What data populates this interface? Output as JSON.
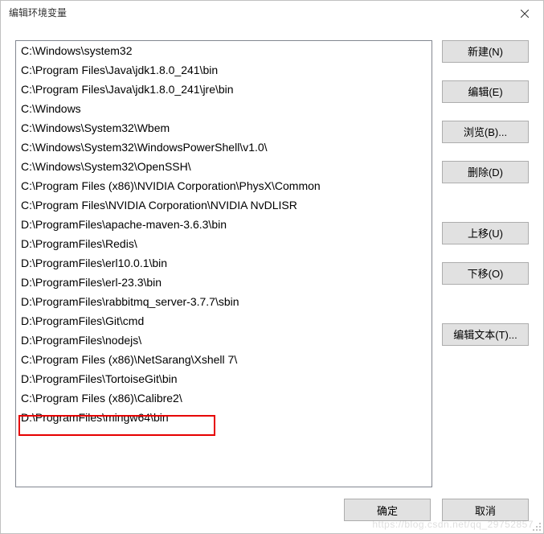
{
  "window": {
    "title": "编辑环境变量"
  },
  "paths": [
    "C:\\Windows\\system32",
    "C:\\Program Files\\Java\\jdk1.8.0_241\\bin",
    "C:\\Program Files\\Java\\jdk1.8.0_241\\jre\\bin",
    "C:\\Windows",
    "C:\\Windows\\System32\\Wbem",
    "C:\\Windows\\System32\\WindowsPowerShell\\v1.0\\",
    "C:\\Windows\\System32\\OpenSSH\\",
    "C:\\Program Files (x86)\\NVIDIA Corporation\\PhysX\\Common",
    "C:\\Program Files\\NVIDIA Corporation\\NVIDIA NvDLISR",
    "D:\\ProgramFiles\\apache-maven-3.6.3\\bin",
    "D:\\ProgramFiles\\Redis\\",
    "D:\\ProgramFiles\\erl10.0.1\\bin",
    "D:\\ProgramFiles\\erl-23.3\\bin",
    "D:\\ProgramFiles\\rabbitmq_server-3.7.7\\sbin",
    "D:\\ProgramFiles\\Git\\cmd",
    "D:\\ProgramFiles\\nodejs\\",
    "C:\\Program Files (x86)\\NetSarang\\Xshell 7\\",
    "D:\\ProgramFiles\\TortoiseGit\\bin",
    "C:\\Program Files (x86)\\Calibre2\\",
    "D:\\ProgramFiles\\mingw64\\bin"
  ],
  "buttons": {
    "new": "新建(N)",
    "edit": "编辑(E)",
    "browse": "浏览(B)...",
    "delete": "删除(D)",
    "up": "上移(U)",
    "down": "下移(O)",
    "editText": "编辑文本(T)...",
    "ok": "确定",
    "cancel": "取消"
  },
  "watermark": "https://blog.csdn.net/qq_29752857"
}
